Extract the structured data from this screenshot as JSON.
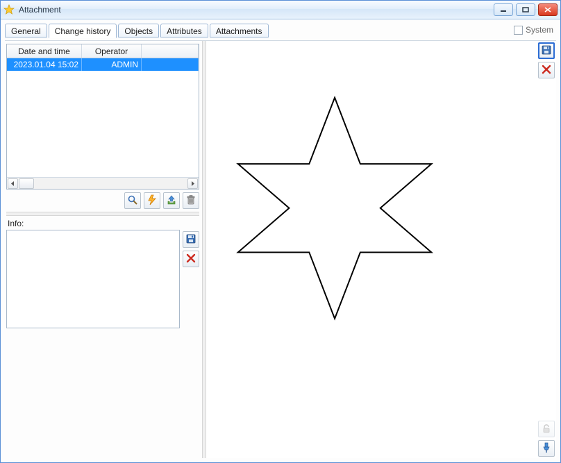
{
  "window": {
    "title": "Attachment"
  },
  "tabs": [
    {
      "label": "General"
    },
    {
      "label": "Change history"
    },
    {
      "label": "Objects"
    },
    {
      "label": "Attributes"
    },
    {
      "label": "Attachments"
    }
  ],
  "active_tab_index": 1,
  "system_checkbox": {
    "label": "System",
    "checked": false
  },
  "history": {
    "columns": {
      "date": "Date and time",
      "operator": "Operator"
    },
    "rows": [
      {
        "date": "2023.01.04 15:02",
        "operator": "ADMIN"
      }
    ],
    "selected_index": 0
  },
  "info": {
    "label": "Info:",
    "value": ""
  },
  "icons": {
    "save": "save-icon",
    "delete": "delete-icon",
    "search": "search-icon",
    "flash": "flash-icon",
    "upload": "upload-icon",
    "trash": "trash-icon",
    "unlock": "unlock-icon",
    "pin": "pin-icon",
    "star": "star-icon"
  }
}
